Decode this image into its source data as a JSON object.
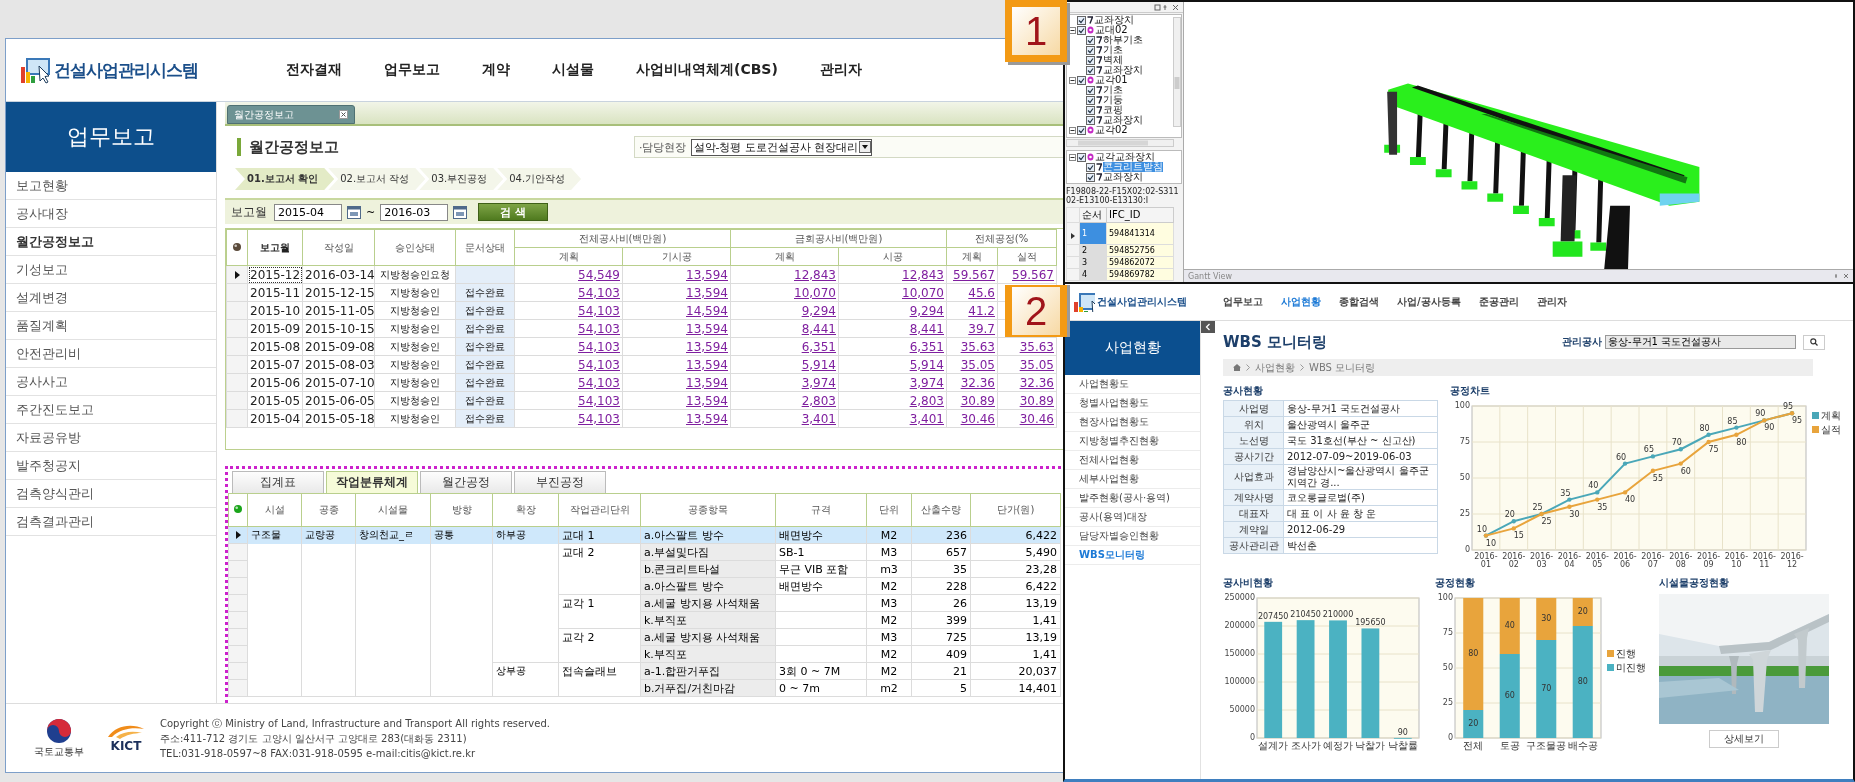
{
  "main": {
    "header": {
      "logo": "건설사업관리시스템",
      "nav": [
        {
          "label": "전자결재",
          "selected": false
        },
        {
          "label": "업무보고",
          "selected": false
        },
        {
          "label": "계약",
          "selected": false
        },
        {
          "label": "시설물",
          "selected": false
        },
        {
          "label": "사업비내역체계(CBS)",
          "selected": false
        },
        {
          "label": "관리자",
          "selected": false
        }
      ]
    },
    "sidebar": {
      "title": "업무보고",
      "items": [
        {
          "label": "보고현황",
          "selected": false
        },
        {
          "label": "공사대장",
          "selected": false
        },
        {
          "label": "월간공정보고",
          "selected": true
        },
        {
          "label": "기성보고",
          "selected": false
        },
        {
          "label": "설계변경",
          "selected": false
        },
        {
          "label": "품질계획",
          "selected": false
        },
        {
          "label": "안전관리비",
          "selected": false
        },
        {
          "label": "공사사고",
          "selected": false
        },
        {
          "label": "주간진도보고",
          "selected": false
        },
        {
          "label": "자료공유방",
          "selected": false
        },
        {
          "label": "발주청공지",
          "selected": false
        },
        {
          "label": "검측양식관리",
          "selected": false
        },
        {
          "label": "검측결과관리",
          "selected": false
        }
      ]
    },
    "doc_tab": {
      "label": "월간공정보고"
    },
    "page_title": "월간공정보고",
    "site": {
      "label": "·담당현장",
      "value": "설악-청평 도로건설공사 현장대리"
    },
    "steps": [
      {
        "label": "01.보고서 확인",
        "selected": true
      },
      {
        "label": "02.보고서 작성",
        "selected": false
      },
      {
        "label": "03.부진공정",
        "selected": false
      },
      {
        "label": "04.기안작성",
        "selected": false
      }
    ],
    "search": {
      "label": "보고월",
      "from": "2015-04",
      "separator": "~",
      "to": "2016-03",
      "button": "검 색"
    },
    "report_table": {
      "columns": [
        "보고월",
        "작성일",
        "승인상태",
        "문서상태"
      ],
      "groups": [
        {
          "label": "전체공사비(백만원)",
          "columns": [
            "계획",
            "기시공"
          ]
        },
        {
          "label": "금회공사비(백만원)",
          "columns": [
            "계획",
            "시공"
          ]
        },
        {
          "label": "전체공정(%",
          "columns": [
            "계획",
            "실적"
          ]
        }
      ],
      "rows": [
        {
          "selected": true,
          "month": "2015-12",
          "written": "2016-03-14",
          "approval": "지방청승인요청",
          "figures": [
            "54,549",
            "13,594",
            "12,843",
            "12,843",
            "59.567",
            "59.567"
          ]
        },
        {
          "selected": false,
          "month": "2015-11",
          "written": "2015-12-15",
          "approval": "지방청승인",
          "status": "접수완료",
          "figures": [
            "54,103",
            "13,594",
            "10,070",
            "10,070",
            "45.6"
          ]
        },
        {
          "selected": false,
          "month": "2015-10",
          "written": "2015-11-05",
          "approval": "지방청승인",
          "status": "접수완료",
          "figures": [
            "54,103",
            "14,594",
            "9,294",
            "9,294",
            "41.2"
          ]
        },
        {
          "selected": false,
          "month": "2015-09",
          "written": "2015-10-15",
          "approval": "지방청승인",
          "status": "접수완료",
          "figures": [
            "54,103",
            "13,594",
            "8,441",
            "8,441",
            "39.7"
          ]
        },
        {
          "selected": false,
          "month": "2015-08",
          "written": "2015-09-08",
          "approval": "지방청승인",
          "status": "접수완료",
          "figures": [
            "54,103",
            "13,594",
            "6,351",
            "6,351",
            "35.63",
            "35.63"
          ]
        },
        {
          "selected": false,
          "month": "2015-07",
          "written": "2015-08-03",
          "approval": "지방청승인",
          "status": "접수완료",
          "figures": [
            "54,103",
            "13,594",
            "5,914",
            "5,914",
            "35.05",
            "35.05"
          ]
        },
        {
          "selected": false,
          "month": "2015-06",
          "written": "2015-07-10",
          "approval": "지방청승인",
          "status": "접수완료",
          "figures": [
            "54,103",
            "13,594",
            "3,974",
            "3,974",
            "32.36",
            "32.36"
          ]
        },
        {
          "selected": false,
          "month": "2015-05",
          "written": "2015-06-05",
          "approval": "지방청승인",
          "status": "접수완료",
          "figures": [
            "54,103",
            "13,594",
            "2,803",
            "2,803",
            "30.89",
            "30.89"
          ]
        },
        {
          "selected": false,
          "month": "2015-04",
          "written": "2015-05-18",
          "approval": "지방청승인",
          "status": "접수완료",
          "figures": [
            "54,103",
            "13,594",
            "3,401",
            "3,401",
            "30.46",
            "30.46"
          ]
        }
      ]
    },
    "detail": {
      "tabs": [
        {
          "label": "집계표",
          "selected": false
        },
        {
          "label": "작업분류체계",
          "selected": true
        },
        {
          "label": "월간공정",
          "selected": false
        },
        {
          "label": "부진공정",
          "selected": false
        }
      ],
      "columns": [
        "시설",
        "공종",
        "시설물",
        "방향",
        "확장",
        "작업관리단위",
        "공종항목",
        "규격",
        "단위",
        "산출수량",
        "단가(원)"
      ],
      "rows": [
        {
          "selected": true,
          "facility": "구조물",
          "work_type": "교량공",
          "structure": "창의천교_ㄹ",
          "direction": "공통",
          "extension": "하부공",
          "unit_of_work": "교대 1",
          "item": "a.아스팔트 방수",
          "spec": "배면방수",
          "unit": "M2",
          "quantity": "236",
          "unit_price": "6,422"
        },
        {
          "selected": false,
          "unit_of_work": "교대 2",
          "item": "a.부설및다짐",
          "spec": "SB-1",
          "unit": "M3",
          "quantity": "657",
          "unit_price": "5,490"
        },
        {
          "selected": false,
          "item": "b.콘크리트타설",
          "spec": "무근 VIB 포함",
          "unit": "m3",
          "quantity": "35",
          "unit_price": "23,28"
        },
        {
          "selected": false,
          "item": "a.아스팔트 방수",
          "spec": "배면방수",
          "unit": "M2",
          "quantity": "228",
          "unit_price": "6,422"
        },
        {
          "selected": false,
          "unit_of_work": "교각 1",
          "item": "a.세굴 방지용 사석채움",
          "unit": "M3",
          "quantity": "26",
          "unit_price": "13,19"
        },
        {
          "selected": false,
          "item": "k.부직포",
          "unit": "M2",
          "quantity": "399",
          "unit_price": "1,41"
        },
        {
          "selected": false,
          "unit_of_work": "교각 2",
          "item": "a.세굴 방지용 사석채움",
          "unit": "M3",
          "quantity": "725",
          "unit_price": "13,19"
        },
        {
          "selected": false,
          "item": "k.부직포",
          "unit": "M2",
          "quantity": "409",
          "unit_price": "1,41"
        },
        {
          "selected": false,
          "extension": "상부공",
          "unit_of_work": "접속슬래브",
          "item": "a-1.합판거푸집",
          "spec": "3회 0 ~ 7M",
          "unit": "M2",
          "quantity": "21",
          "unit_price": "20,037"
        },
        {
          "selected": false,
          "item": "b.거푸집/거친마감",
          "spec": "0 ~ 7m",
          "unit": "m2",
          "quantity": "5",
          "unit_price": "14,401"
        }
      ]
    },
    "footer": {
      "logos": [
        {
          "kind": "ministry",
          "caption": "국토교통부"
        },
        {
          "kind": "kict",
          "caption": "KICT"
        }
      ],
      "lines": [
        "Copyright ⓒ Ministry of Land, Infrastructure and Transport All rights reserved.",
        "주소:411-712 경기도 고양시 일산서구 고양대로 283(대화동 2311)",
        "TEL:031-918-0597~8 FAX:031-918-0595 e-mail:citis@kict.re.kr"
      ]
    }
  },
  "badges": [
    "1",
    "2"
  ],
  "bim_viewer": {
    "tree": [
      {
        "label": "교좌장치",
        "checked": true,
        "selected": false
      },
      {
        "label": "교대02",
        "checked": true,
        "selected": false,
        "expanded": true,
        "children": [
          {
            "label": "하부기초",
            "checked": true,
            "selected": false
          },
          {
            "label": "기초",
            "checked": true,
            "selected": false
          },
          {
            "label": "벽체",
            "checked": true,
            "selected": false
          },
          {
            "label": "교좌장치",
            "checked": true,
            "selected": false
          }
        ]
      },
      {
        "label": "교각01",
        "checked": true,
        "selected": false,
        "expanded": true,
        "children": [
          {
            "label": "기초",
            "checked": true,
            "selected": false
          },
          {
            "label": "기둥",
            "checked": true,
            "selected": false
          },
          {
            "label": "코핑",
            "checked": true,
            "selected": false
          },
          {
            "label": "교좌장치",
            "checked": true,
            "selected": false
          }
        ]
      },
      {
        "label": "교각02",
        "checked": true,
        "selected": false,
        "expanded": true
      }
    ],
    "sub_tree": [
      {
        "label": "교각교좌장치",
        "checked": true,
        "selected": false,
        "expanded": true,
        "children": [
          {
            "label": "콘크리트받침",
            "checked": true,
            "selected": true
          },
          {
            "label": "교좌장치",
            "checked": true,
            "selected": false
          }
        ]
      }
    ],
    "path": "F19808-22-F15X02:02-S31102-E13100-E13130:I",
    "grid": {
      "columns": [
        "순서",
        "IFC_ID"
      ],
      "rows": [
        {
          "selected": true,
          "cells": [
            "1",
            "594841314"
          ]
        },
        {
          "selected": false,
          "cells": [
            "2",
            "594852756"
          ]
        },
        {
          "selected": false,
          "cells": [
            "3",
            "594862072"
          ]
        },
        {
          "selected": false,
          "cells": [
            "4",
            "594869782"
          ]
        }
      ]
    },
    "gantt_title": "Gantt View"
  },
  "wbs_monitor": {
    "header": {
      "logo": "건설사업관리시스템",
      "nav": [
        {
          "label": "업무보고",
          "selected": false
        },
        {
          "label": "사업현황",
          "selected": true
        },
        {
          "label": "종합검색",
          "selected": false
        },
        {
          "label": "사업/공사등록",
          "selected": false
        },
        {
          "label": "준공관리",
          "selected": false
        },
        {
          "label": "관리자",
          "selected": false
        }
      ]
    },
    "sidebar": {
      "title": "사업현황",
      "items": [
        {
          "label": "사업현황도",
          "selected": false
        },
        {
          "label": "청별사업현황도",
          "selected": false
        },
        {
          "label": "현장사업현황도",
          "selected": false
        },
        {
          "label": "지방청별추진현황",
          "selected": false
        },
        {
          "label": "전체사업현황",
          "selected": false
        },
        {
          "label": "세부사업현황",
          "selected": false
        },
        {
          "label": "발주현황(공사·용역)",
          "selected": false
        },
        {
          "label": "공사(용역)대장",
          "selected": false
        },
        {
          "label": "담당자별승인현황",
          "selected": false
        },
        {
          "label": "WBS모니터링",
          "selected": true
        }
      ]
    },
    "title": "WBS 모니터링",
    "project": {
      "label": "관리공사",
      "value": "웅상-무거1 국도건설공사"
    },
    "breadcrumb": [
      "사업현황",
      "WBS 모니터링"
    ],
    "overview": {
      "title": "공사현황",
      "rows": [
        {
          "label": "사업명",
          "value": "웅상-무거1 국도건설공사"
        },
        {
          "label": "위치",
          "value": "울산광역시 울주군"
        },
        {
          "label": "노선명",
          "value": "국도 31호선(부산 ~ 신고산)"
        },
        {
          "label": "공사기간",
          "value": "2012-07-09~2019-06-03"
        },
        {
          "label": "사업효과",
          "value": "경남양산시~울산광역시 울주군 지역간 경..."
        },
        {
          "label": "계약사명",
          "value": "코오롱글로벌(주)"
        },
        {
          "label": "대표자",
          "value": "대 표 이 사 윤 창 운"
        },
        {
          "label": "계약일",
          "value": "2012-06-29"
        },
        {
          "label": "공사관리관",
          "value": "박선춘"
        }
      ]
    },
    "progress_chart": {
      "title": "공정차트",
      "chart_data": {
        "type": "line",
        "categories": [
          "2016-01",
          "2016-02",
          "2016-03",
          "2016-04",
          "2016-05",
          "2016-06",
          "2016-07",
          "2016-08",
          "2016-09",
          "2016-10",
          "2016-11",
          "2016-12"
        ],
        "series": [
          {
            "name": "계획",
            "color": "#4aa7b8",
            "values": [
              10,
              20,
              25,
              35,
              40,
              60,
              65,
              70,
              80,
              85,
              90,
              95
            ]
          },
          {
            "name": "실적",
            "color": "#e8a43c",
            "values": [
              10,
              15,
              25,
              30,
              35,
              40,
              55,
              60,
              75,
              80,
              90,
              95
            ]
          }
        ],
        "ylim": [
          0,
          100
        ],
        "yticks": [
          0,
          25,
          50,
          75,
          100
        ],
        "data_labels": true,
        "grid": true,
        "legend": true
      }
    },
    "cost_chart": {
      "title": "공사비현황",
      "chart_data": {
        "type": "bar",
        "categories": [
          "설계가",
          "조사가",
          "예정가",
          "낙찰가",
          "낙찰률"
        ],
        "series": [
          {
            "color": "#4bb2c2",
            "values": [
              207450,
              210450,
              210000,
              195650,
              90
            ]
          }
        ],
        "ylim": [
          0,
          250000
        ],
        "yticks": [
          0,
          50000,
          100000,
          150000,
          200000,
          250000
        ],
        "data_labels": true,
        "grid": true
      }
    },
    "status_chart": {
      "title": "공정현황",
      "chart_data": {
        "type": "bar",
        "stacked": true,
        "categories": [
          "전체",
          "토공",
          "구조물공",
          "배수공"
        ],
        "series": [
          {
            "name": "미진행",
            "color": "#4bb2c2",
            "values": [
              20,
              60,
              70,
              80
            ]
          },
          {
            "name": "진행",
            "color": "#e8a43c",
            "values": [
              80,
              40,
              30,
              20
            ]
          }
        ],
        "ylim": [
          0,
          100
        ],
        "yticks": [
          0,
          25,
          50,
          75,
          100
        ],
        "data_labels": true,
        "grid": true,
        "legend": true
      }
    },
    "facility": {
      "title": "시설물공정현황",
      "button": "상세보기"
    }
  }
}
